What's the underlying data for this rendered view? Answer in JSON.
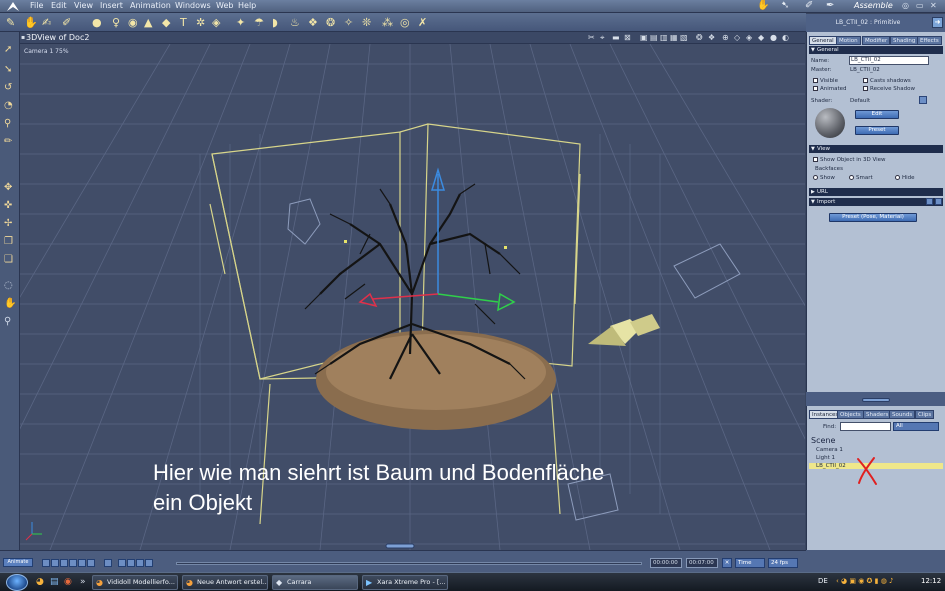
{
  "menubar": {
    "items": [
      "File",
      "Edit",
      "View",
      "Insert",
      "Animation",
      "Windows",
      "Web",
      "Help"
    ],
    "room": "Assemble"
  },
  "viewport": {
    "title": "3DView of Doc2",
    "camera": "Camera 1 75%",
    "annotation": "Hier wie man siehrt ist Baum und Bodenfläche\nein Objekt"
  },
  "properties": {
    "title": "LB_CTII_02 : Primitive",
    "tabs": [
      "General",
      "Motion",
      "Modifier",
      "Shading",
      "Effects"
    ],
    "general": {
      "section": "General",
      "name_label": "Name:",
      "name_value": "LB_CTII_02",
      "master_label": "Master:",
      "master_value": "LB_CTII_02",
      "visible": "Visible",
      "casts_shadows": "Casts shadows",
      "animated": "Animated",
      "receive_shadow": "Receive Shadow",
      "shader_label": "Shader:",
      "shader_value": "Default",
      "edit": "Edit",
      "preset": "Preset"
    },
    "view": {
      "section": "View",
      "show_object": "Show Object in 3D View",
      "backfaces": "Backfaces",
      "show": "Show",
      "smart": "Smart",
      "hide": "Hide"
    },
    "url": "URL",
    "import": {
      "section": "Import",
      "preset": "Preset (Pose, Material)"
    }
  },
  "browser": {
    "tabs": [
      "Instances",
      "Objects",
      "Shaders",
      "Sounds",
      "Clips"
    ],
    "find_label": "Find:",
    "filter": "All",
    "scene_title": "Scene",
    "items": [
      "Camera 1",
      "Light 1",
      "LB_CTII_02"
    ]
  },
  "timeline": {
    "animate": "Animate",
    "time_current": "00:00:00",
    "time_end": "00:07:00",
    "time_mode": "Time",
    "fps": "24 fps"
  },
  "taskbar": {
    "buttons": [
      "Vididoll Modellierfo...",
      "Neue Antwort erstel...",
      "Carrara",
      "Xara Xtreme Pro - [..."
    ],
    "lang": "DE",
    "clock": "12:12"
  },
  "colors": {
    "accent": "#5577b3",
    "viewport_bg": "#414d68",
    "panel_bg": "#b3c0d3",
    "selection": "#efe78a",
    "annotation_mark": "#e02020"
  }
}
